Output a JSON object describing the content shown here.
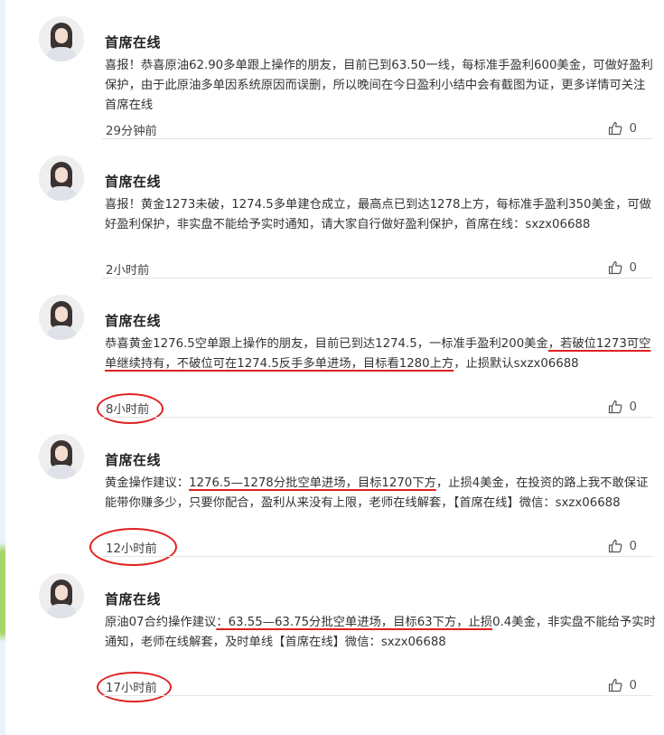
{
  "accent_color": "#e02020",
  "posts": [
    {
      "author": "首席在线",
      "content": [
        "喜报！恭喜原油62.90多单跟上操作的朋友，目前已到63.50一线，每标准手盈利600美金，可做好盈利保护，由于此原油多单因系统原因而误删，所以晚间在今日盈利小结中会有截图为证，更多详情可关注首席在线"
      ],
      "time": "29分钟前",
      "likes": "0"
    },
    {
      "author": "首席在线",
      "content": [
        "喜报！黄金1273未破，1274.5多单建仓成立，最高点已到达1278上方，每标准手盈利350美金，可做好盈利保护，非实盘不能给予实时通知，请大家自行做好盈利保护，首席在线：sxzx06688"
      ],
      "time": "2小时前",
      "likes": "0"
    },
    {
      "author": "首席在线",
      "content": [
        "恭喜黄金1276.5空单跟上操作的朋友，目前已到达1274.5，一标准手盈利200美金",
        "，若破位1273可空单继续持有，不破位可在1274.5反手多单进场，目标看1280上方",
        "，止损默认sxzx06688"
      ],
      "time": "8小时前",
      "likes": "0"
    },
    {
      "author": "首席在线",
      "content": [
        "黄金操作建议：",
        "1276.5—1278分批空单进场，目标1270下方",
        "，止损4美金，在投资的路上我不敢保证能带你赚多少，只要你配合，盈利从来没有上限，老师在线解套，【首席在线】微信：sxzx06688"
      ],
      "time": "12小时前",
      "likes": "0"
    },
    {
      "author": "首席在线",
      "content": [
        "原油07合约操作建议",
        "：63.55—63.75分批空单进场，目标63下方，止损",
        "0.4美金，非实盘不能给予实时通知，老师在线解套，及时单线【首席在线】微信：sxzx06688"
      ],
      "time": "17小时前",
      "likes": "0"
    }
  ]
}
